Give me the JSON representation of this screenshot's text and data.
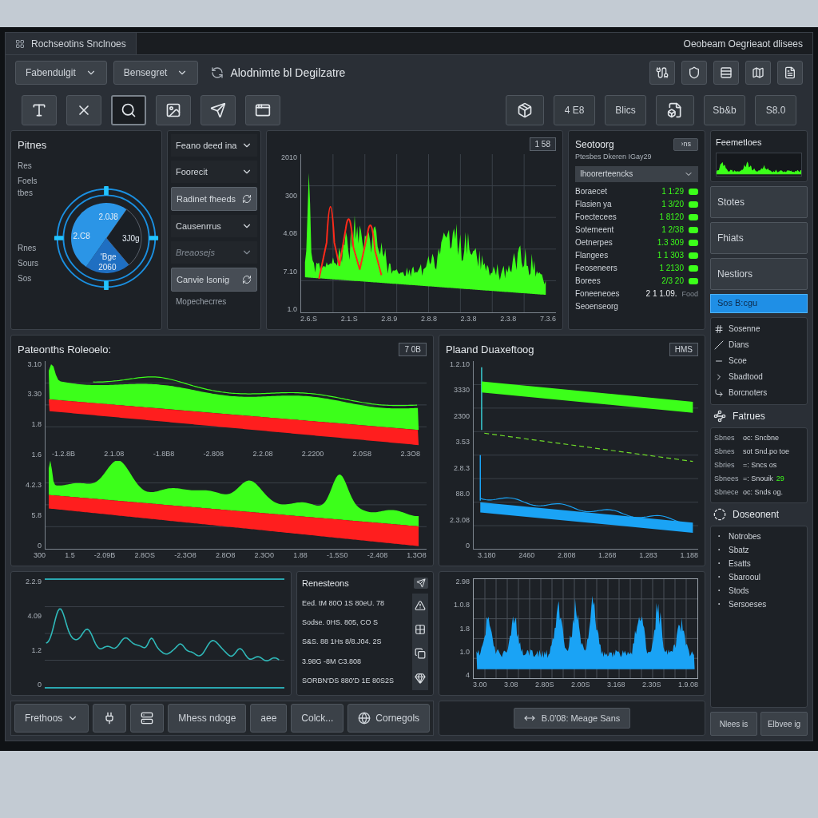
{
  "window": {
    "title": "Rochseotins Snclnoes",
    "caption": "Oeobeam Oegrieaot dlisees"
  },
  "toolbar": {
    "dropdowns": [
      "Fabendulgit",
      "Bensegret"
    ],
    "heading": "Alodnimte bl Degilzatre",
    "tools": [
      {
        "selected": false
      },
      {
        "selected": false
      },
      {
        "selected": true
      },
      {
        "selected": false
      },
      {
        "selected": false
      },
      {
        "selected": false
      }
    ],
    "actions": [
      {
        "kind": "icon"
      },
      {
        "kind": "text",
        "label": "4 E8"
      },
      {
        "kind": "text",
        "label": "Blics"
      },
      {
        "kind": "icon"
      },
      {
        "kind": "text",
        "label": "Sb&b"
      },
      {
        "kind": "text",
        "label": "S8.0"
      }
    ]
  },
  "gauge_panel": {
    "title": "Pitnes",
    "legend_top": [
      "Res",
      "Foels tbes"
    ],
    "legend_bottom": [
      "Rnes",
      "Sours",
      "Sos"
    ],
    "slice_labels": [
      "2.0J8",
      "2.C8",
      "3J0g",
      "'Bge",
      "2060"
    ]
  },
  "filters": {
    "items": [
      {
        "kind": "dropdown",
        "label": "Feano deed ina",
        "disabled": false
      },
      {
        "kind": "dropdown",
        "label": "Foorecit",
        "disabled": false
      },
      {
        "kind": "button",
        "label": "Radinet fheeds",
        "disabled": false
      },
      {
        "kind": "dropdown",
        "label": "Causenrrus",
        "disabled": false
      },
      {
        "kind": "dropdown",
        "label": "Breaosejs",
        "disabled": true
      },
      {
        "kind": "button",
        "label": "Canvie lsonig",
        "disabled": false
      }
    ],
    "note": "Mopechecrres"
  },
  "spectrum_chart": {
    "badge": "1 58",
    "y_labels": [
      "2010",
      "300",
      "4.08",
      "7.10",
      "1.0"
    ],
    "x_labels": [
      "2.6.S",
      "2.1.S",
      "2.8.9",
      "2.8.8",
      "2.3.8",
      "2.3.8",
      "7.3.6"
    ]
  },
  "stats_panel": {
    "title": "Seotoorg",
    "subtitle": "Ptesbes Dkeren IGay29",
    "action": "›ns",
    "dropdown": "Ihoorerteencks",
    "rows": [
      {
        "kind": "pill",
        "label": "Boraecet",
        "value": "1 1:29"
      },
      {
        "kind": "pill",
        "label": "Flasien ya",
        "value": "1 3/20"
      },
      {
        "kind": "pill",
        "label": "Foectecees",
        "value": "1 8120"
      },
      {
        "kind": "pill",
        "label": "Sotemeent",
        "value": "1 2/38"
      },
      {
        "kind": "pill",
        "label": "Oetnerpes",
        "value": "1.3 309"
      },
      {
        "kind": "pill",
        "label": "Flangees",
        "value": "1 1 303"
      },
      {
        "kind": "pill",
        "label": "Feoseneers",
        "value": "1 2130"
      },
      {
        "kind": "pill",
        "label": "Borees",
        "value": "2/3 20"
      },
      {
        "kind": "tag",
        "label": "Foneeneoes",
        "value": "2 1 1.09.",
        "tag": "Food"
      },
      {
        "kind": "plain",
        "label": "Seoenseorg"
      }
    ]
  },
  "trend_panel": {
    "title": "Pateonths Roleoelo:",
    "badge": "7 0B",
    "y_labels": [
      "3.10",
      "3.30",
      "1.8",
      "1.6",
      "4.2.3",
      "5.8",
      "0"
    ],
    "mid_x_labels": [
      "-1.2.8B",
      "2.1.08",
      "-1.8B8",
      "-2.808",
      "2.2.08",
      "2.2200",
      "2.0S8",
      "2.3O8"
    ],
    "x_labels": [
      "300",
      "1.5",
      "-2.09B",
      "2.8OS",
      "-2.3O8",
      "2.8O8",
      "2.3O0",
      "1.88",
      "-1.5S0",
      "-2.408",
      "1.3O8"
    ]
  },
  "wave_chart": {
    "y_labels": [
      "2.2.9",
      "4.09",
      "1.2",
      "0"
    ]
  },
  "log_panel": {
    "title": "Renesteons",
    "lines": [
      "Eed. tM 80O 1S 80eU. 78",
      "Sodse. 0HS. 805, CO S",
      "S&S. 88 1Hs 8/8.J04. 2S",
      "3.98G -8M C3.808",
      "SORBN'DS 880'D 1E 80S2S"
    ]
  },
  "bottom_buttons": [
    {
      "kind": "dropdown",
      "label": "Frethoos"
    },
    {
      "kind": "icon"
    },
    {
      "kind": "icon"
    },
    {
      "kind": "text",
      "label": "Mhess ndoge"
    },
    {
      "kind": "text",
      "label": "aee"
    },
    {
      "kind": "text",
      "label": "Colck..."
    },
    {
      "kind": "icon_text",
      "label": "Cornegols"
    }
  ],
  "level_panel": {
    "title": "Plaand Duaxeftoog",
    "badge": "HMS",
    "y_labels": [
      "1.2.10",
      "3330",
      "2300",
      "3.53",
      "2.8.3",
      "88.0",
      "2.3.08",
      "0"
    ],
    "x_labels": [
      "3.180",
      "2460",
      "2.808",
      "1.268",
      "1.283",
      "1.188"
    ]
  },
  "spike_chart": {
    "y_labels": [
      "2.98",
      "1.0.8",
      "1.8",
      "1.0",
      "4"
    ],
    "x_labels": [
      "3.00",
      "3.08",
      "2.80S",
      "2.00S",
      "3.168",
      "2.30S",
      "1.9.08"
    ]
  },
  "status_bar": {
    "chip": "B.0'08: Meage Sans"
  },
  "side_panel": {
    "title": "Feemetloes",
    "buttons": [
      "Stotes",
      "Fhiats",
      "Nestiors"
    ],
    "filter": {
      "label": "Sos B:cgu",
      "selected": true
    },
    "nav_items": [
      "Sosenne",
      "Dians",
      "Scoe",
      "Sbadtood",
      "Borcnoters"
    ],
    "features_title": "Fatrues",
    "features": [
      {
        "label": "Sbnes",
        "value": "oc: Sncbne"
      },
      {
        "label": "Sbnes",
        "value": "sot Snd.po toe"
      },
      {
        "label": "Sbries",
        "value": "=: Sncs os"
      },
      {
        "label": "Sbnees",
        "value": "=: Snouik",
        "note": "29"
      },
      {
        "label": "Sbnece",
        "value": "oc: Snds og."
      }
    ],
    "documents_title": "Doseonent",
    "documents": [
      "Notrobes",
      "Sbatz",
      "Esatts",
      "Sbarooul",
      "Stods",
      "Sersoeses"
    ],
    "footer_buttons": [
      "Nlees is",
      "Elbvee ig"
    ]
  }
}
